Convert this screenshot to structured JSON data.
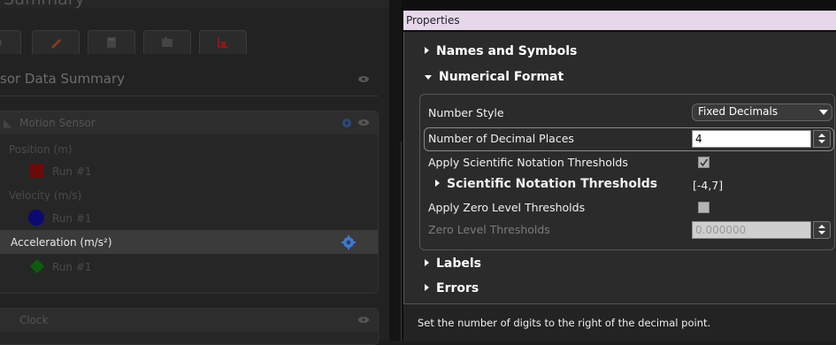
{
  "left_panel": {
    "window_title": "Summary",
    "tab_icons": [
      "sensor-icon",
      "pencil-icon",
      "calculator-icon",
      "camera-icon",
      "graph-icon"
    ],
    "summary_title": "sor Data Summary",
    "motion_sensor": {
      "title": "Motion Sensor",
      "position_label": "Position (m)",
      "position_run": "Run #1",
      "velocity_label": "Velocity (m/s)",
      "velocity_run": "Run #1",
      "acceleration_label": "Acceleration (m/s²)",
      "acceleration_run": "Run #1"
    },
    "clock_title": "Clock",
    "colors": {
      "position": "#8b0a0a",
      "velocity": "#0a0a8b",
      "acceleration": "#0b6b0b",
      "gear": "#3a7bd5"
    }
  },
  "properties": {
    "title": "Properties",
    "sections": {
      "names_symbols": "Names and Symbols",
      "numerical_format": "Numerical Format",
      "labels": "Labels",
      "errors": "Errors"
    },
    "number_style": {
      "label": "Number Style",
      "value": "Fixed Decimals"
    },
    "decimal_places": {
      "label": "Number of Decimal Places",
      "value": "4"
    },
    "apply_sci": {
      "label": "Apply Scientific Notation Thresholds",
      "checked": true
    },
    "sci_thresholds": {
      "label": "Scientific Notation Thresholds",
      "value": "[-4,7]"
    },
    "apply_zero": {
      "label": "Apply Zero Level Thresholds",
      "checked": false
    },
    "zero_thresholds": {
      "label": "Zero Level Thresholds",
      "value": "0.000000"
    },
    "status_text": "Set the number of digits to the right of the decimal point."
  }
}
